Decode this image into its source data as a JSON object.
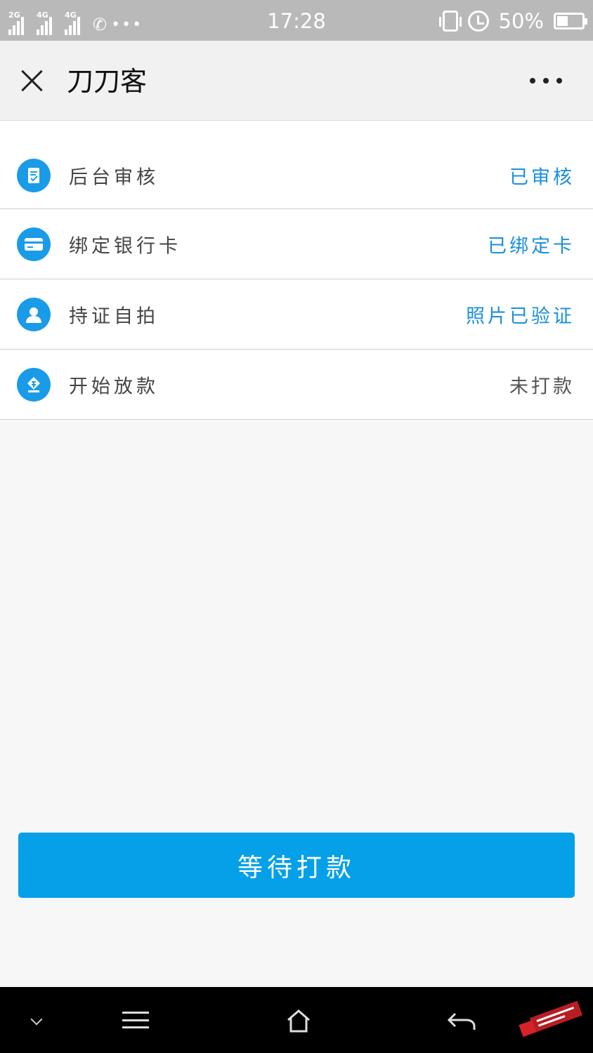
{
  "status_bar": {
    "time": "17:28",
    "battery_text": "50%",
    "battery_level": 0.5,
    "networks": [
      "2G",
      "4G",
      "4G"
    ],
    "dots": "•••"
  },
  "nav": {
    "title": "刀刀客"
  },
  "steps": [
    {
      "icon": "review-document-icon",
      "label": "后台审核",
      "status": "已审核",
      "state": "done"
    },
    {
      "icon": "bank-card-icon",
      "label": "绑定银行卡",
      "status": "已绑定卡",
      "state": "done"
    },
    {
      "icon": "user-icon",
      "label": "持证自拍",
      "status": "照片已验证",
      "state": "done"
    },
    {
      "icon": "loan-release-icon",
      "label": "开始放款",
      "status": "未打款",
      "state": "pending"
    }
  ],
  "action": {
    "button_label": "等待打款"
  },
  "colors": {
    "accent": "#05a0e8",
    "done_text": "#1a8fdc",
    "pending_text": "#555555"
  }
}
